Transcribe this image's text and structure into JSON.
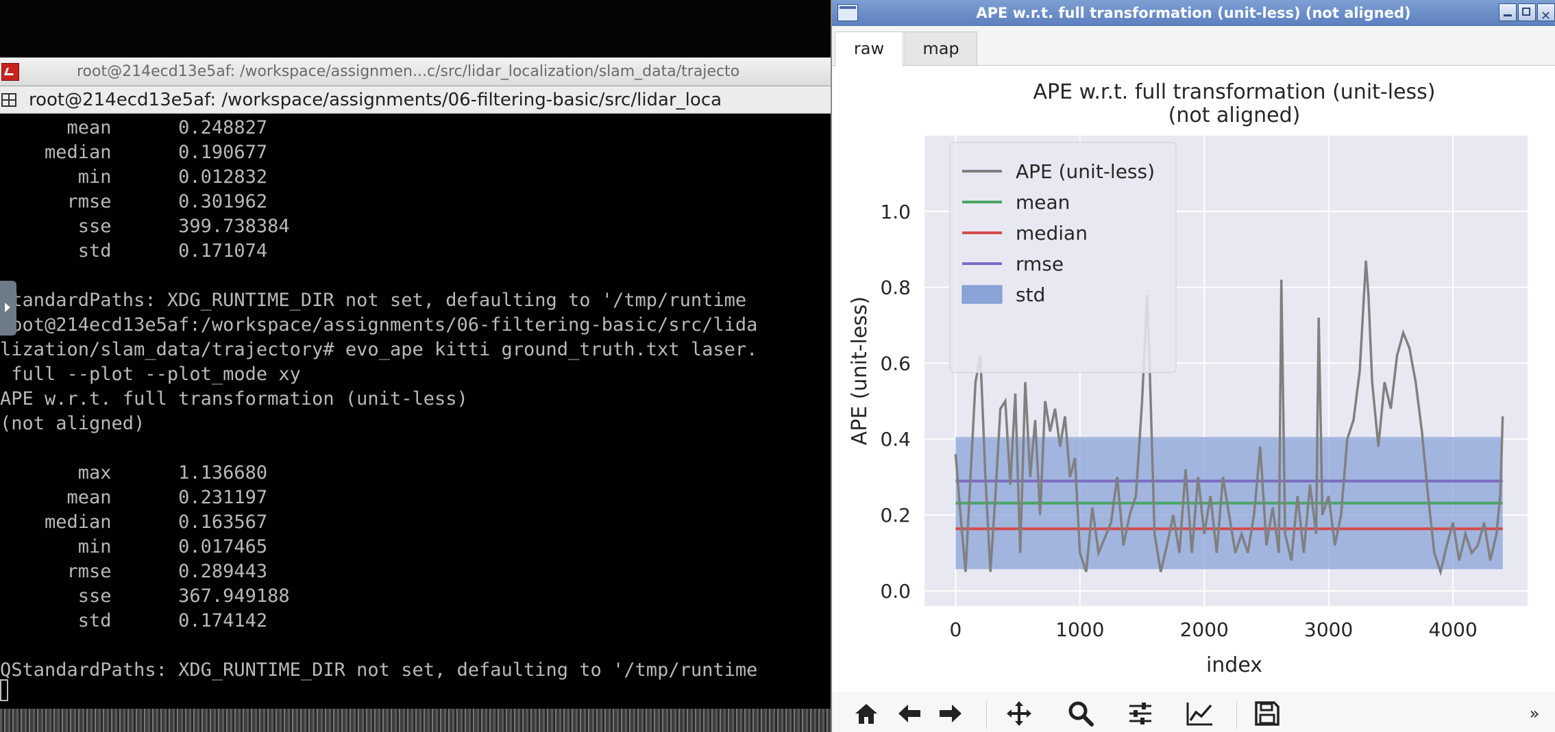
{
  "terminal": {
    "window_title": "root@214ecd13e5af: /workspace/assignmen...c/src/lidar_localization/slam_data/trajecto",
    "tab_title": "root@214ecd13e5af: /workspace/assignments/06-filtering-basic/src/lidar_loca",
    "lines": [
      "      mean      0.248827",
      "    median      0.190677",
      "       min      0.012832",
      "      rmse      0.301962",
      "       sse      399.738384",
      "       std      0.171074",
      "",
      "StandardPaths: XDG_RUNTIME_DIR not set, defaulting to '/tmp/runtime",
      "root@214ecd13e5af:/workspace/assignments/06-filtering-basic/src/lida",
      "lization/slam_data/trajectory# evo_ape kitti ground_truth.txt laser.",
      " full --plot --plot_mode xy",
      "APE w.r.t. full transformation (unit-less)",
      "(not aligned)",
      "",
      "       max      1.136680",
      "      mean      0.231197",
      "    median      0.163567",
      "       min      0.017465",
      "      rmse      0.289443",
      "       sse      367.949188",
      "       std      0.174142",
      "",
      "QStandardPaths: XDG_RUNTIME_DIR not set, defaulting to '/tmp/runtime"
    ]
  },
  "plot_window": {
    "title": "APE w.r.t. full transformation (unit-less) (not aligned)",
    "tabs": [
      {
        "label": "raw",
        "active": true
      },
      {
        "label": "map",
        "active": false
      }
    ],
    "toolbar": [
      {
        "name": "home-icon"
      },
      {
        "name": "back-arrow-icon"
      },
      {
        "name": "forward-arrow-icon"
      },
      {
        "name": "pan-icon"
      },
      {
        "name": "zoom-icon"
      },
      {
        "name": "configure-subplots-icon"
      },
      {
        "name": "edit-axis-icon"
      },
      {
        "name": "save-icon"
      }
    ],
    "overflow_label": "»"
  },
  "chart_data": {
    "type": "line",
    "title": "APE w.r.t. full transformation (unit-less)",
    "subtitle": "(not aligned)",
    "xlabel": "index",
    "ylabel": "APE (unit-less)",
    "xlim": [
      -250,
      4600
    ],
    "ylim": [
      -0.04,
      1.2
    ],
    "xticks": [
      0,
      1000,
      2000,
      3000,
      4000
    ],
    "xtick_labels": [
      "0",
      "1000",
      "2000",
      "3000",
      "4000"
    ],
    "yticks": [
      0.0,
      0.2,
      0.4,
      0.6,
      0.8,
      1.0
    ],
    "ytick_labels": [
      "0.0",
      "0.2",
      "0.4",
      "0.6",
      "0.8",
      "1.0"
    ],
    "grid": true,
    "legend_position": "top-left",
    "colors": {
      "ape": "#808080",
      "mean": "#4aa564",
      "median": "#d54b4b",
      "rmse": "#7a6cc2",
      "std": "#8aa4d8",
      "bg": "#e8e8f2"
    },
    "series": [
      {
        "name": "APE (unit-less)",
        "x": [
          0,
          40,
          80,
          120,
          160,
          200,
          240,
          280,
          320,
          360,
          400,
          440,
          480,
          520,
          560,
          600,
          640,
          680,
          720,
          760,
          800,
          840,
          880,
          920,
          960,
          1000,
          1050,
          1100,
          1150,
          1200,
          1250,
          1300,
          1350,
          1400,
          1450,
          1500,
          1540,
          1560,
          1600,
          1650,
          1700,
          1750,
          1800,
          1850,
          1900,
          1950,
          2000,
          2050,
          2100,
          2150,
          2200,
          2250,
          2300,
          2350,
          2400,
          2450,
          2500,
          2550,
          2600,
          2620,
          2650,
          2700,
          2750,
          2800,
          2850,
          2900,
          2920,
          2950,
          3000,
          3050,
          3100,
          3150,
          3200,
          3250,
          3300,
          3320,
          3350,
          3400,
          3450,
          3500,
          3550,
          3600,
          3650,
          3700,
          3750,
          3800,
          3850,
          3900,
          3950,
          4000,
          4050,
          4100,
          4150,
          4200,
          4250,
          4300,
          4350,
          4380,
          4400
        ],
        "y": [
          0.36,
          0.2,
          0.05,
          0.3,
          0.55,
          0.62,
          0.3,
          0.05,
          0.25,
          0.48,
          0.5,
          0.28,
          0.52,
          0.1,
          0.55,
          0.3,
          0.45,
          0.2,
          0.5,
          0.42,
          0.48,
          0.38,
          0.46,
          0.3,
          0.35,
          0.1,
          0.05,
          0.22,
          0.1,
          0.14,
          0.18,
          0.3,
          0.12,
          0.2,
          0.25,
          0.5,
          0.78,
          0.6,
          0.15,
          0.05,
          0.12,
          0.2,
          0.1,
          0.32,
          0.1,
          0.3,
          0.15,
          0.25,
          0.1,
          0.3,
          0.2,
          0.1,
          0.15,
          0.1,
          0.2,
          0.38,
          0.12,
          0.22,
          0.1,
          0.82,
          0.15,
          0.08,
          0.25,
          0.1,
          0.28,
          0.15,
          0.72,
          0.2,
          0.25,
          0.12,
          0.2,
          0.4,
          0.45,
          0.58,
          0.87,
          0.78,
          0.55,
          0.38,
          0.55,
          0.48,
          0.62,
          0.68,
          0.64,
          0.55,
          0.42,
          0.25,
          0.1,
          0.05,
          0.12,
          0.18,
          0.08,
          0.15,
          0.1,
          0.12,
          0.18,
          0.08,
          0.15,
          0.25,
          0.46
        ]
      },
      {
        "name": "mean",
        "value": 0.231197
      },
      {
        "name": "median",
        "value": 0.163567
      },
      {
        "name": "rmse",
        "value": 0.289443
      },
      {
        "name": "std",
        "value": 0.174142
      }
    ]
  }
}
